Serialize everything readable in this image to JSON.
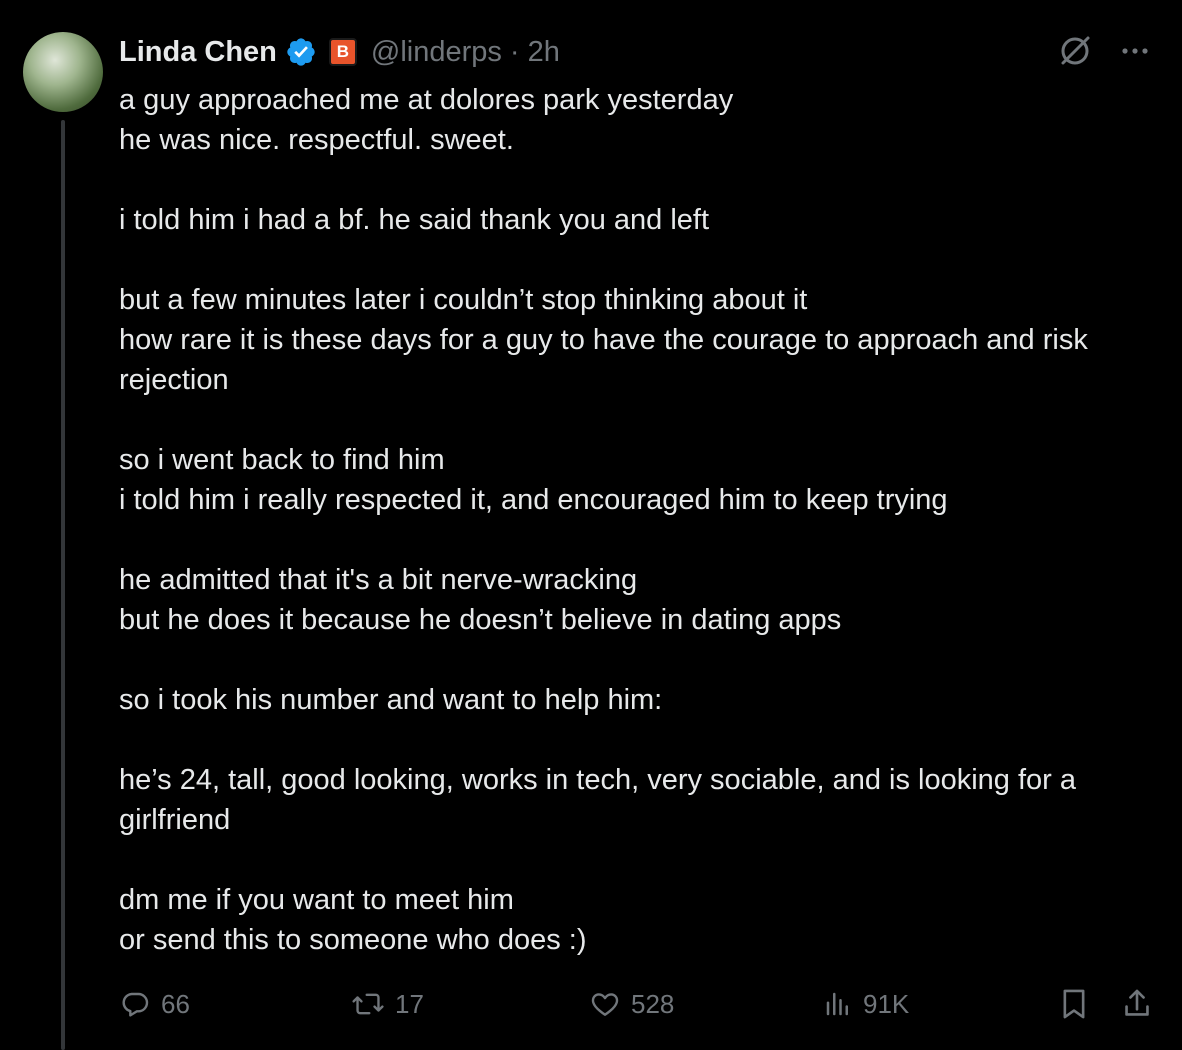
{
  "author": {
    "name": "Linda Chen",
    "affiliate_badge": "B",
    "handle": "@linderps",
    "separator": "·",
    "time": "2h"
  },
  "header_icons": [
    "grok-icon",
    "more-icon"
  ],
  "post": {
    "paragraphs": [
      [
        "a guy approached me at dolores park yesterday",
        "he was nice. respectful. sweet."
      ],
      [
        "i told him i had a bf. he said thank you and left"
      ],
      [
        "but a few minutes later i couldn’t stop thinking about it",
        "how rare it is these days for a guy to have the courage to approach and risk rejection"
      ],
      [
        "so i went back to find him",
        "i told him i really respected it, and encouraged him to keep trying"
      ],
      [
        "he admitted that it's a bit nerve-wracking",
        "but he does it because he doesn’t believe in dating apps"
      ],
      [
        "so i took his number and want to help him:"
      ],
      [
        "he’s 24, tall, good looking, works in tech, very sociable, and is looking for a girlfriend"
      ],
      [
        "dm me if you want to meet him",
        "or send this to someone who does :)"
      ]
    ]
  },
  "actions": {
    "replies": "66",
    "reposts": "17",
    "likes": "528",
    "views": "91K"
  },
  "colors": {
    "background": "#000000",
    "text": "#e7e9ea",
    "muted": "#71767b",
    "verified": "#1d9bf0",
    "affiliate": "#e8542b"
  }
}
